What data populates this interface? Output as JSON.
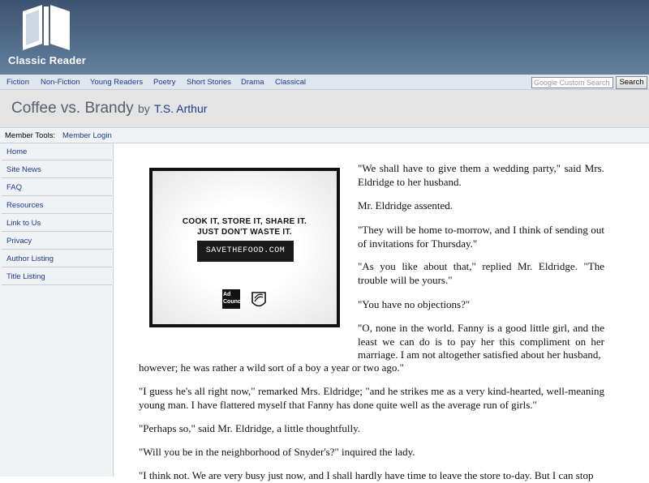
{
  "header": {
    "site_name": "Classic Reader",
    "logo_icon": "open-book-icon"
  },
  "topnav": {
    "links": [
      "Fiction",
      "Non-Fiction",
      "Young Readers",
      "Poetry",
      "Short Stories",
      "Drama",
      "Classical"
    ],
    "search_placeholder": "Google Custom Search",
    "search_button": "Search"
  },
  "book": {
    "title": "Coffee vs. Brandy",
    "by": "by",
    "author": "T.S. Arthur"
  },
  "member_tools": {
    "label": "Member Tools:",
    "login": "Member Login"
  },
  "sidebar": {
    "items": [
      "Home",
      "Site News",
      "FAQ",
      "Resources",
      "Link to Us",
      "Privacy",
      "Author Listing",
      "Title Listing"
    ]
  },
  "ad": {
    "line1": "COOK IT, STORE IT, SHARE IT.",
    "line2": "JUST DON'T WASTE IT.",
    "url": "SAVETHEFOOD.COM",
    "logo_left": "Ad Council",
    "logo_right": "NRDC"
  },
  "text": {
    "p1": "\"We shall have to give them a wedding party,\" said Mrs. Eldridge to her husband.",
    "p2": "Mr. Eldridge assented.",
    "p3": "\"They will be home to-morrow, and I think of sending out of invitations for Thursday.\"",
    "p4": "\"As you like about that,\" replied Mr. Eldridge. \"The trouble will be yours.\"",
    "p5": "\"You have no objections?\"",
    "p6a": "\"O, none in the world. Fanny is a good little girl, and the least we can do is to pay her this compliment on her marriage. I am not altogether satisfied about her husband,",
    "p6b": "however; he was rather a wild sort of a boy a year or two ago.\"",
    "p7": "\"I guess he's all right now,\" remarked Mrs. Eldridge; \"and he strikes me as a very kind-hearted, well-meaning young man. I have flattered myself that Fanny has done quite well as the average run of girls.\"",
    "p8": "\"Perhaps so,\" said Mr. Eldridge, a little thoughtfully.",
    "p9": "\"Will you be in the neighborhood of Snyder's?\" inquired the lady.",
    "p10": "\"I think not. We are very busy just now, and I shall hardly have time to leave the store to-day. But I can stop"
  },
  "colors": {
    "header_top": "#3c5270",
    "header_bottom": "#63809e",
    "link": "#1a3b8a",
    "sidebar_bg": "#f0f3f6",
    "titlebar_bg": "#e4e4e4"
  }
}
